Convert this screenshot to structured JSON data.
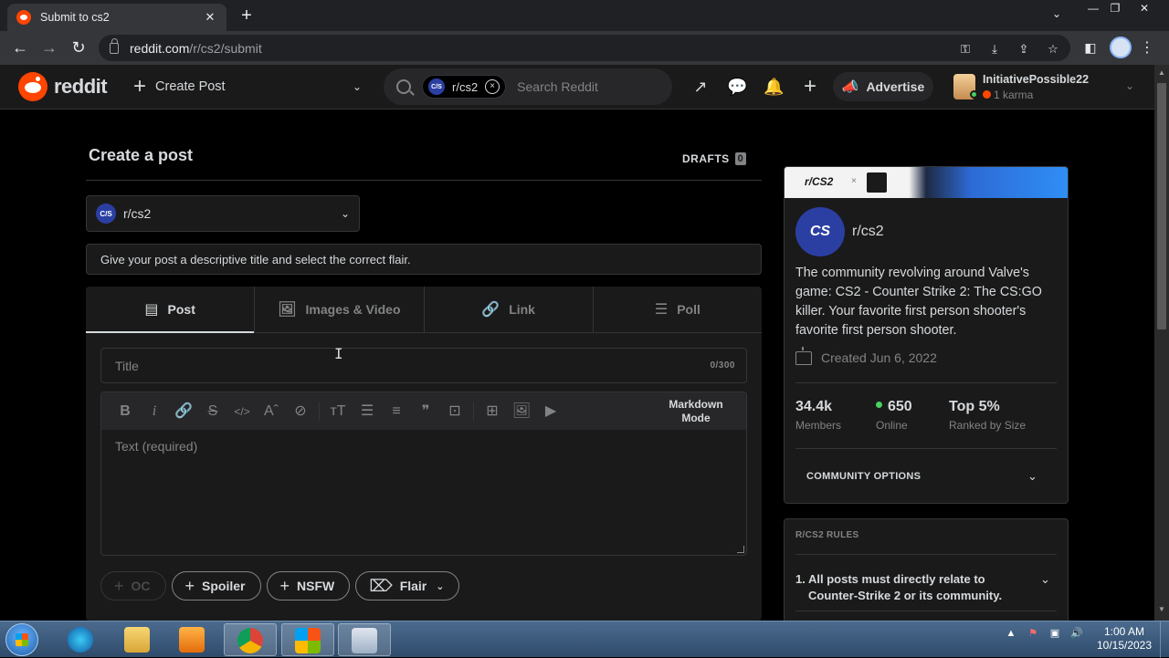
{
  "browser": {
    "tab_title": "Submit to cs2",
    "tab_close": "✕",
    "new_tab": "+",
    "url_host": "reddit.com",
    "url_path": "/r/cs2/submit",
    "win_min": "—",
    "win_restore": "❐",
    "win_close": "✕",
    "tab_search": "⌄"
  },
  "header": {
    "logo_text": "reddit",
    "create_post_label": "Create Post",
    "search_chip_label": "r/cs2",
    "search_placeholder": "Search Reddit",
    "advertise_label": "Advertise",
    "user_name": "InitiativePossible22",
    "user_karma": "1 karma"
  },
  "main": {
    "page_title": "Create a post",
    "drafts_label": "DRAFTS",
    "drafts_count": "0",
    "community_selected": "r/cs2",
    "hint_text": "Give your post a descriptive title and select the correct flair.",
    "tabs": [
      {
        "label": "Post",
        "icon": "document-icon",
        "active": true
      },
      {
        "label": "Images & Video",
        "icon": "image-icon",
        "active": false
      },
      {
        "label": "Link",
        "icon": "link-icon",
        "active": false
      },
      {
        "label": "Poll",
        "icon": "poll-icon",
        "active": false
      }
    ],
    "title_placeholder": "Title",
    "title_counter": "0/300",
    "markdown_mode_line1": "Markdown",
    "markdown_mode_line2": "Mode",
    "body_placeholder": "Text (required)",
    "toolbar_icons": [
      "bold-icon",
      "italic-icon",
      "link-icon",
      "strikethrough-icon",
      "inline-code-icon",
      "superscript-icon",
      "spoiler-icon",
      "heading-icon",
      "bulleted-list-icon",
      "numbered-list-icon",
      "quote-block-icon",
      "code-block-icon",
      "table-icon",
      "image-icon",
      "video-icon"
    ],
    "pills": {
      "oc": "OC",
      "spoiler": "Spoiler",
      "nsfw": "NSFW",
      "flair": "Flair"
    }
  },
  "sidebar": {
    "banner_text": "r/CS2",
    "banner_x": "×",
    "subreddit_name": "r/cs2",
    "icon_text": "CS",
    "description": "The community revolving around Valve's game: CS2 - Counter Strike 2: The CS:GO killer. Your favorite first person shooter's favorite first person shooter.",
    "created": "Created Jun 6, 2022",
    "stats": [
      {
        "value": "34.4k",
        "label": "Members"
      },
      {
        "value": "650",
        "label": "Online"
      },
      {
        "value": "Top 5%",
        "label": "Ranked by Size"
      }
    ],
    "community_options": "COMMUNITY OPTIONS",
    "rules_title": "R/CS2 RULES",
    "rule1_num": "1.",
    "rule1_line1": "All posts must directly relate to",
    "rule1_line2": "Counter-Strike 2 or its community."
  },
  "taskbar": {
    "time": "1:00 AM",
    "date": "10/15/2023"
  },
  "colors": {
    "reddit_orange": "#ff4500",
    "bg": "#000000",
    "card": "#1a1a1b",
    "border": "#343536",
    "text": "#d7dadc",
    "muted": "#818384",
    "online": "#46d160"
  }
}
